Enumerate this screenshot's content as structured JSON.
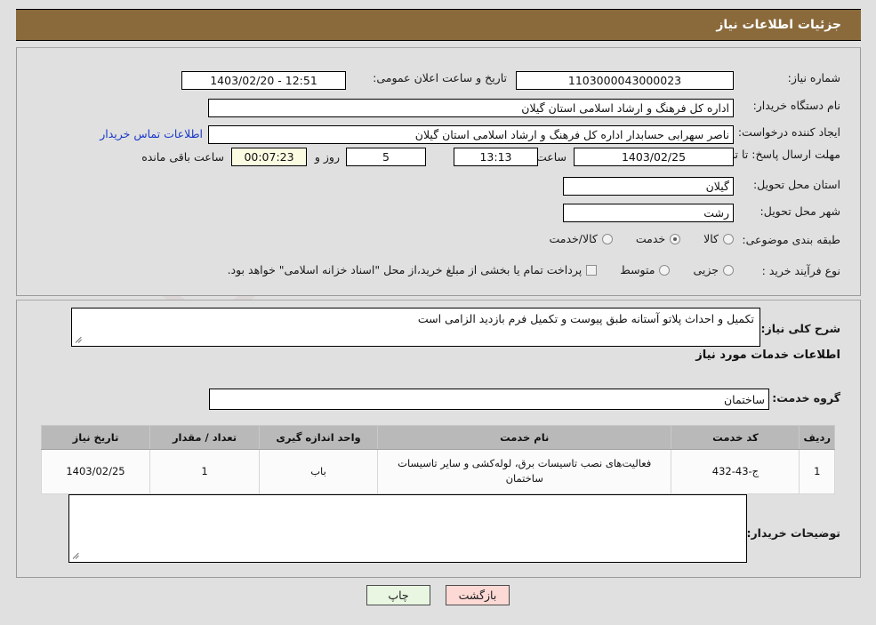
{
  "header": {
    "title": "جزئیات اطلاعات نیاز"
  },
  "form": {
    "need_number": {
      "label": "شماره نیاز:",
      "value": "1103000043000023"
    },
    "announce_datetime": {
      "label": "تاریخ و ساعت اعلان عمومی:",
      "value": "12:51 - 1403/02/20"
    },
    "buyer_org": {
      "label": "نام دستگاه خریدار:",
      "value": "اداره کل فرهنگ و ارشاد اسلامی استان گیلان"
    },
    "requester": {
      "label": "ایجاد کننده درخواست:",
      "value": "ناصر سهرابی حسابدار اداره کل فرهنگ و ارشاد اسلامی استان گیلان",
      "contact_link": "اطلاعات تماس خریدار"
    },
    "deadline": {
      "label": "مهلت ارسال پاسخ: تا تاریخ:",
      "date": "1403/02/25",
      "time_label": "ساعت",
      "time": "13:13",
      "days": "5",
      "days_label": "روز و",
      "countdown": "00:07:23",
      "remaining_label": "ساعت باقی مانده"
    },
    "province": {
      "label": "استان محل تحویل:",
      "value": "گیلان"
    },
    "city": {
      "label": "شهر محل تحویل:",
      "value": "رشت"
    },
    "category": {
      "label": "طبقه بندی موضوعی:",
      "options": [
        {
          "label": "کالا",
          "selected": false
        },
        {
          "label": "خدمت",
          "selected": true
        },
        {
          "label": "کالا/خدمت",
          "selected": false
        }
      ]
    },
    "purchase_type": {
      "label": "نوع فرآیند خرید :",
      "options": [
        {
          "label": "جزیی",
          "selected": false
        },
        {
          "label": "متوسط",
          "selected": false
        }
      ],
      "checkbox_label": "پرداخت تمام یا بخشی از مبلغ خرید،از محل \"اسناد خزانه اسلامی\" خواهد بود.",
      "checkbox_checked": false
    }
  },
  "details": {
    "need_description": {
      "label": "شرح کلی نیاز:",
      "value": "تکمیل  و احداث پلاتو آستانه طبق پیوست و تکمیل فرم بازدید الزامی است"
    },
    "services_heading": "اطلاعات خدمات مورد نیاز",
    "service_group": {
      "label": "گروه خدمت:",
      "value": "ساختمان"
    },
    "buyer_notes": {
      "label": "توضیحات خریدار:",
      "value": ""
    }
  },
  "table": {
    "columns": [
      "ردیف",
      "کد خدمت",
      "نام خدمت",
      "واحد اندازه گیری",
      "تعداد / مقدار",
      "تاریخ نیاز"
    ],
    "rows": [
      {
        "row_no": "1",
        "service_code": "ج-43-432",
        "service_name": "فعالیت‌های نصب تاسیسات برق، لوله‌کشی و سایر تاسیسات ساختمان",
        "unit": "باب",
        "quantity": "1",
        "need_date": "1403/02/25"
      }
    ]
  },
  "buttons": {
    "print": "چاپ",
    "back": "بازگشت"
  },
  "colors": {
    "header_bg": "#8a6a3b",
    "page_bg": "#e0e0e0",
    "link": "#1a39c8",
    "table_header_bg": "#b9b9b9",
    "print_btn_bg": "#e8f6e2",
    "back_btn_bg": "#fcd9d5",
    "countdown_bg": "#fbfbe2"
  },
  "watermark": {
    "text": "AnaTender.net"
  }
}
